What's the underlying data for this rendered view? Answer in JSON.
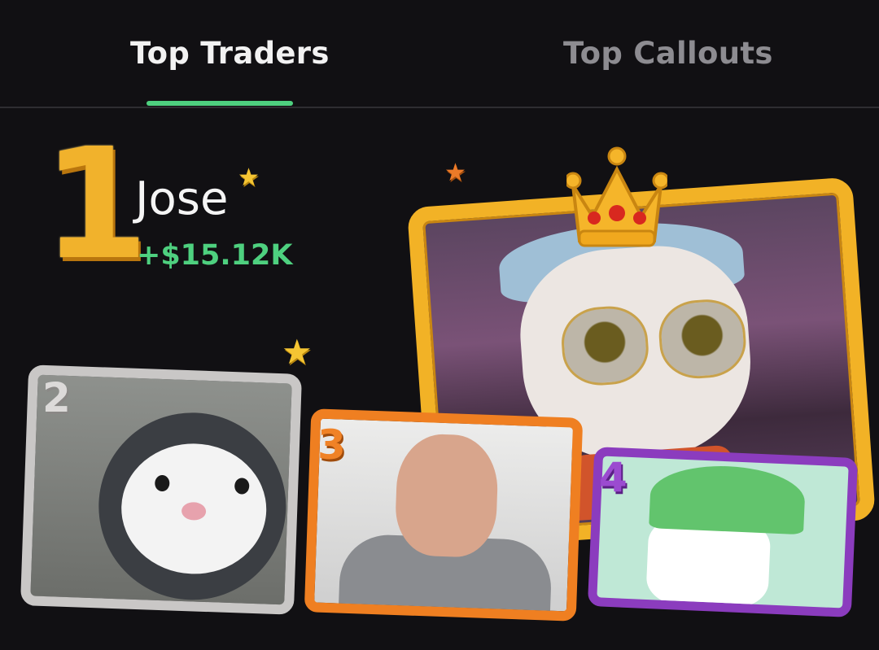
{
  "tabs": [
    {
      "label": "Top Traders",
      "active": true
    },
    {
      "label": "Top Callouts",
      "active": false
    }
  ],
  "leader": {
    "rank": "1",
    "name": "Jose",
    "pnl": "+$15.12K"
  },
  "runners_up": [
    {
      "rank": "2",
      "avatar": "hamster-in-hood"
    },
    {
      "rank": "3",
      "avatar": "man-in-hoodie"
    },
    {
      "rank": "4",
      "avatar": "cartoon-green-cap"
    }
  ],
  "colors": {
    "accent_green": "#4ed07f",
    "gold": "#f2b226",
    "silver": "#c9c7c6",
    "bronze": "#ef7f21",
    "purple": "#8b3cbe",
    "background": "#111013"
  }
}
